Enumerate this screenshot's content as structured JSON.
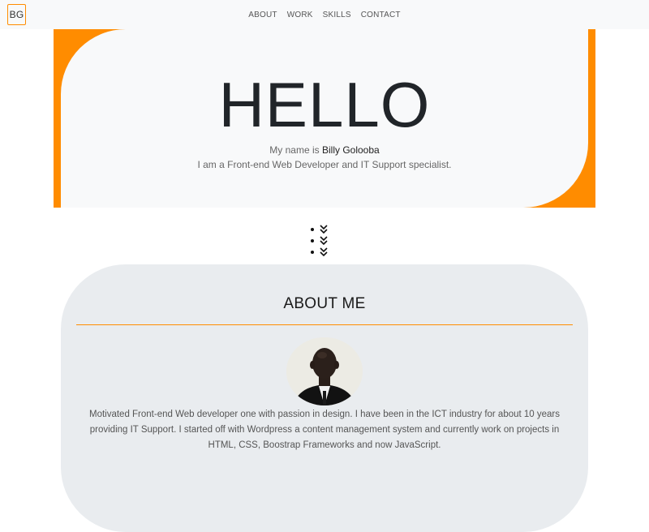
{
  "nav": {
    "logo": "BG",
    "links": [
      "ABOUT",
      "WORK",
      "SKILLS",
      "CONTACT"
    ]
  },
  "hero": {
    "title": "HELLO",
    "name_prefix": "My name is",
    "name": "Billy Golooba",
    "role": "I am a Front-end Web Developer and IT Support specialist."
  },
  "scroll_indicator": {
    "icon": "chevron-double-down-icon"
  },
  "about": {
    "title": "ABOUT ME",
    "avatar_icon": "profile-photo",
    "text": "Motivated Front-end Web developer one with passion in design. I have been in the ICT industry for about 10 years providing IT Support. I started off with Wordpress a content management system and currently work on projects in HTML, CSS, Boostrap Frameworks and now JavaScript."
  },
  "colors": {
    "accent": "#ff8c00",
    "hero_bg": "#f8f9fa",
    "about_bg": "#e9ecef"
  }
}
